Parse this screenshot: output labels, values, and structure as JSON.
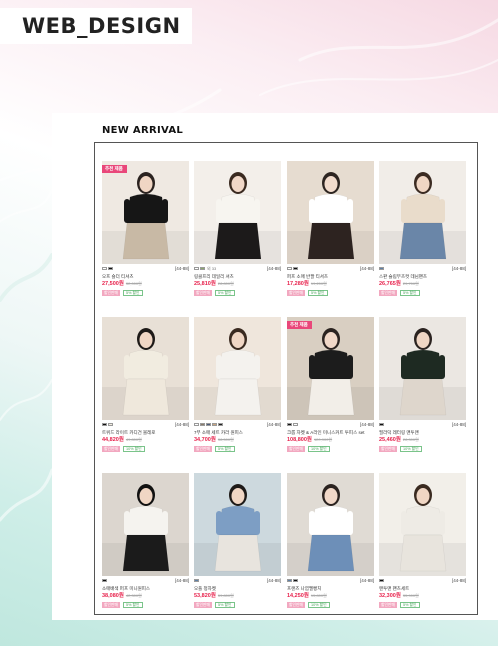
{
  "header": {
    "title": "WEB_DESIGN"
  },
  "section": {
    "title": "NEW ARRIVAL"
  },
  "colors": {
    "accent": "#e7204b",
    "badge": "#e9477a",
    "sale_tag": "#f2a8c0",
    "discount_tag": "#4aa35d"
  },
  "products": [
    {
      "badge": "추천 제품",
      "size": "[44-88]",
      "name": "오프 숄더 티셔츠",
      "price": "27,500원",
      "old_price": "32,000원",
      "tag_sale": "할인판매",
      "tag_discount": "5% 할인",
      "swatch_label": "",
      "swatches": [
        "#ffffff",
        "#111111"
      ]
    },
    {
      "badge": "",
      "size": "[44-88]",
      "name": "링클프리 데일리 셔츠",
      "price": "25,810원",
      "old_price": "28,800원",
      "tag_sale": "할인판매",
      "tag_discount": "5% 할인",
      "swatch_label": "외 33",
      "swatches": [
        "#ffffff",
        "#8aa86c"
      ]
    },
    {
      "badge": "",
      "size": "[44-88]",
      "name": "퍼프 소매 반팔 티셔츠",
      "price": "17,280원",
      "old_price": "19,200원",
      "tag_sale": "할인판매",
      "tag_discount": "5% 할인",
      "swatch_label": "",
      "swatches": [
        "#ffffff",
        "#111111"
      ]
    },
    {
      "badge": "",
      "size": "[44-88]",
      "name": "스판 슬림부츠컷 데님팬츠",
      "price": "26,765원",
      "old_price": "29,700원",
      "tag_sale": "할인판매",
      "tag_discount": "5% 할인",
      "swatch_label": "",
      "swatches": [
        "#5d7fa6"
      ]
    },
    {
      "badge": "",
      "size": "[44-88]",
      "name": "트위드 라이트 카디건 볼레로",
      "price": "44,820원",
      "old_price": "49,800원",
      "tag_sale": "할인판매",
      "tag_discount": "10% 할인",
      "swatch_label": "",
      "swatches": [
        "#111111",
        "#f1ece0"
      ]
    },
    {
      "badge": "",
      "size": "[44-88]",
      "name": "7부 소매 세트 카라 원피스",
      "price": "34,700원",
      "old_price": "38,500원",
      "tag_sale": "할인판매",
      "tag_discount": "5% 할인",
      "swatch_label": "",
      "swatches": [
        "#ffffff",
        "#8a7c6b",
        "#4a5a7a",
        "#c9a57f",
        "#222222"
      ]
    },
    {
      "badge": "추천 제품",
      "size": "[44-88]",
      "name": "크롭 자켓 & A라인 미니스커트 투피스 set",
      "price": "108,800원",
      "old_price": "120,900원",
      "tag_sale": "할인판매",
      "tag_discount": "10% 할인",
      "swatch_label": "",
      "swatches": [
        "#111111",
        "#ffffff"
      ]
    },
    {
      "badge": "",
      "size": "[44-88]",
      "name": "필라덕 레터링 맨투맨",
      "price": "25,460원",
      "old_price": "28,300원",
      "tag_sale": "할인판매",
      "tag_discount": "10% 할인",
      "swatch_label": "",
      "swatches": [
        "#111111"
      ]
    },
    {
      "badge": "",
      "size": "[44-88]",
      "name": "소매배색 퍼프 미니원피스",
      "price": "38,080원",
      "old_price": "42,300원",
      "tag_sale": "할인판매",
      "tag_discount": "5% 할인",
      "swatch_label": "",
      "swatches": [
        "#111111"
      ]
    },
    {
      "badge": "",
      "size": "[44-88]",
      "name": "오플 청자켓",
      "price": "53,820원",
      "old_price": "59,800원",
      "tag_sale": "할인판매",
      "tag_discount": "5% 할인",
      "swatch_label": "",
      "swatches": [
        "#5d7fa6"
      ]
    },
    {
      "badge": "",
      "size": "[44-88]",
      "name": "프랜즈 나염멜빵치",
      "price": "14,250원",
      "old_price": "15,800원",
      "tag_sale": "할인판매",
      "tag_discount": "10% 할인",
      "swatch_label": "",
      "swatches": [
        "#5d7fa6",
        "#111111"
      ]
    },
    {
      "badge": "",
      "size": "[44-88]",
      "name": "맨투맨 팬츠세트",
      "price": "32,300원",
      "old_price": "35,900원",
      "tag_sale": "할인판매",
      "tag_discount": "5% 할인",
      "swatch_label": "",
      "swatches": [
        "#111111"
      ]
    }
  ]
}
